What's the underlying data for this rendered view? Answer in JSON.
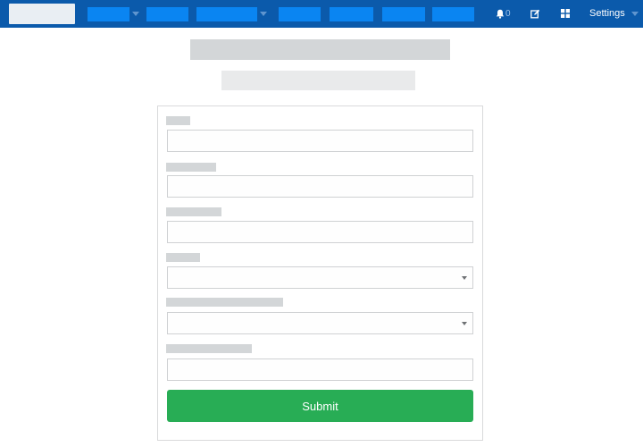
{
  "navbar": {
    "background_color": "#0b5aab",
    "item_color": "#0a85f2",
    "notifications": {
      "icon": "bell-icon",
      "count": "0"
    },
    "edit_icon": "pencil-square-icon",
    "apps_icon": "grid-icon",
    "settings_label": "Settings"
  },
  "form": {
    "fields": [
      {
        "type": "text"
      },
      {
        "type": "text"
      },
      {
        "type": "text"
      },
      {
        "type": "select"
      },
      {
        "type": "select"
      },
      {
        "type": "text"
      }
    ],
    "submit_label": "Submit",
    "submit_color": "#28ad55"
  }
}
